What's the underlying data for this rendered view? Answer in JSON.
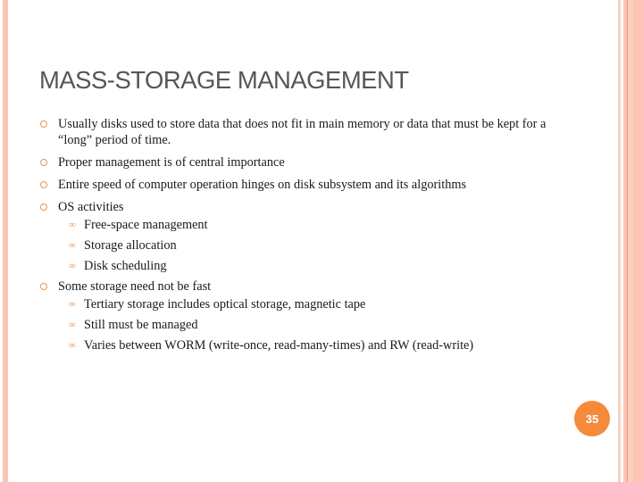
{
  "slide": {
    "title": "MASS-STORAGE MANAGEMENT",
    "page_number": "35",
    "accent_color": "#f58a3a",
    "bullets": [
      {
        "text": "Usually disks used to store data that does not fit in main memory or data that must be kept for a “long” period of time.",
        "subitems": []
      },
      {
        "text": "Proper management is of central importance",
        "subitems": []
      },
      {
        "text": "Entire speed of computer operation hinges on disk subsystem and its algorithms",
        "subitems": []
      },
      {
        "text": "OS activities",
        "subitems": [
          "Free-space management",
          "Storage allocation",
          "Disk scheduling"
        ]
      },
      {
        "text": "Some storage need not be fast",
        "subitems": [
          "Tertiary storage includes optical storage, magnetic tape",
          "Still must be managed",
          "Varies between WORM (write-once, read-many-times) and RW (read-write)"
        ]
      }
    ],
    "bullet_icon": "hollow-circle-icon",
    "subbullet_icon": "curl-ornament-icon"
  }
}
